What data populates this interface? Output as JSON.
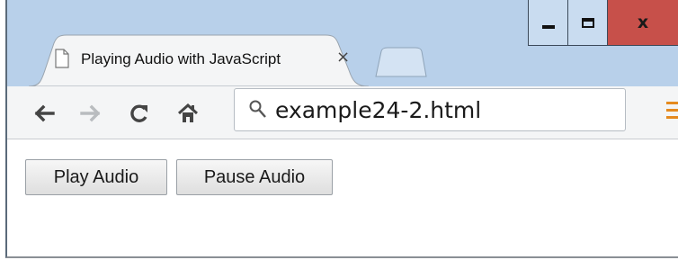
{
  "window": {
    "controls": {
      "minimize_icon": "minimize-icon",
      "maximize_icon": "maximize-icon",
      "close_glyph": "x"
    }
  },
  "tabs": [
    {
      "title": "Playing Audio with JavaScript",
      "close_glyph": "×",
      "icon": "page-icon"
    }
  ],
  "toolbar": {
    "back_icon": "back-arrow-icon",
    "forward_icon": "forward-arrow-icon",
    "reload_icon": "reload-icon",
    "home_icon": "home-icon",
    "menu_icon": "menu-icon",
    "address": "example24-2.html"
  },
  "page": {
    "buttons": {
      "play_label": "Play Audio",
      "pause_label": "Pause Audio"
    }
  },
  "colors": {
    "titlebar": "#b8d0ea",
    "close_button": "#c7504a",
    "menu_accent": "#e58a1f"
  }
}
